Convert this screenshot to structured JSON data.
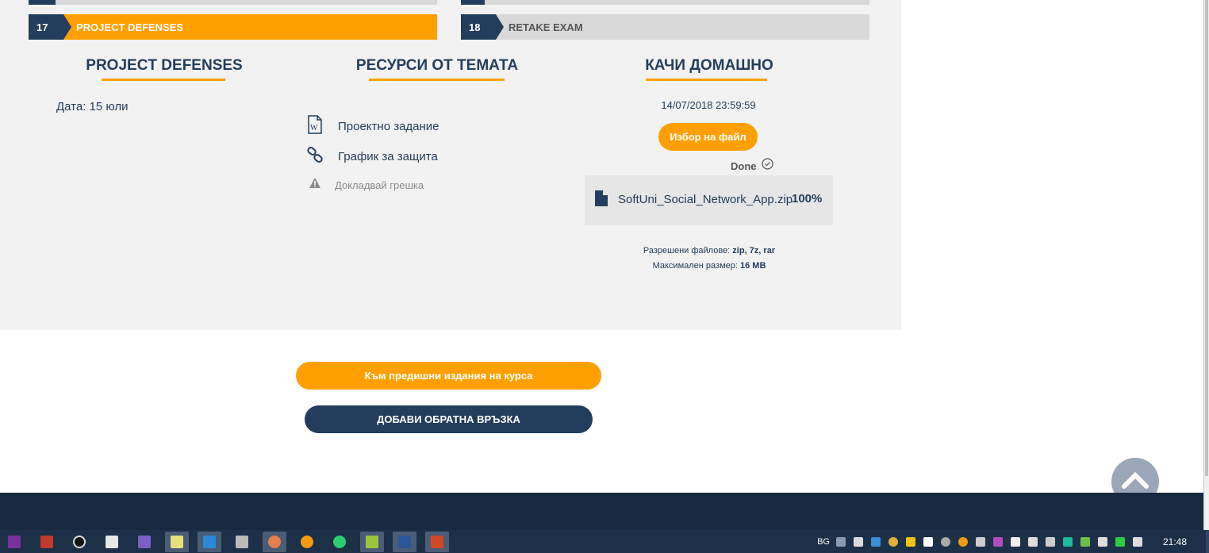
{
  "page": {
    "lectures": [
      {
        "number": "17",
        "title": "PROJECT DEFENSES",
        "active": true
      },
      {
        "number": "18",
        "title": "RETAKE EXAM",
        "active": false
      }
    ],
    "columns": {
      "info": {
        "title": "PROJECT DEFENSES",
        "date_text": "Дата: 15 юли"
      },
      "resources": {
        "title": "РЕСУРСИ ОТ ТЕМАТА",
        "items": [
          {
            "label": "Проектно задание",
            "icon": "word-document-icon"
          },
          {
            "label": "График за защита",
            "icon": "link-icon"
          }
        ],
        "report_label": "Докладвай грешка"
      },
      "homework": {
        "title": "КАЧИ ДОМАШНО",
        "deadline": "14/07/2018 23:59:59",
        "choose_file_label": "Избор на файл",
        "status_label": "Done",
        "file_name": "SoftUni_Social_Network_App.zip",
        "file_progress_text": "100%",
        "allowed_label": "Разрешени файлове:",
        "allowed_value": "zip, 7z, rar",
        "max_size_label": "Максимален размер:",
        "max_size_value": "16 MB"
      }
    },
    "buttons": {
      "previous_editions": "Към предишни издания на курса",
      "add_feedback": "ДОБАВИ ОБРАТНА ВРЪЗКА"
    }
  },
  "taskbar": {
    "language": "BG",
    "time": "21:48"
  },
  "colors": {
    "accent": "#ffa000",
    "navy": "#233d5c",
    "footer": "#16293f",
    "taskbar": "#1c3047",
    "section_bg": "#f2f2f2"
  }
}
